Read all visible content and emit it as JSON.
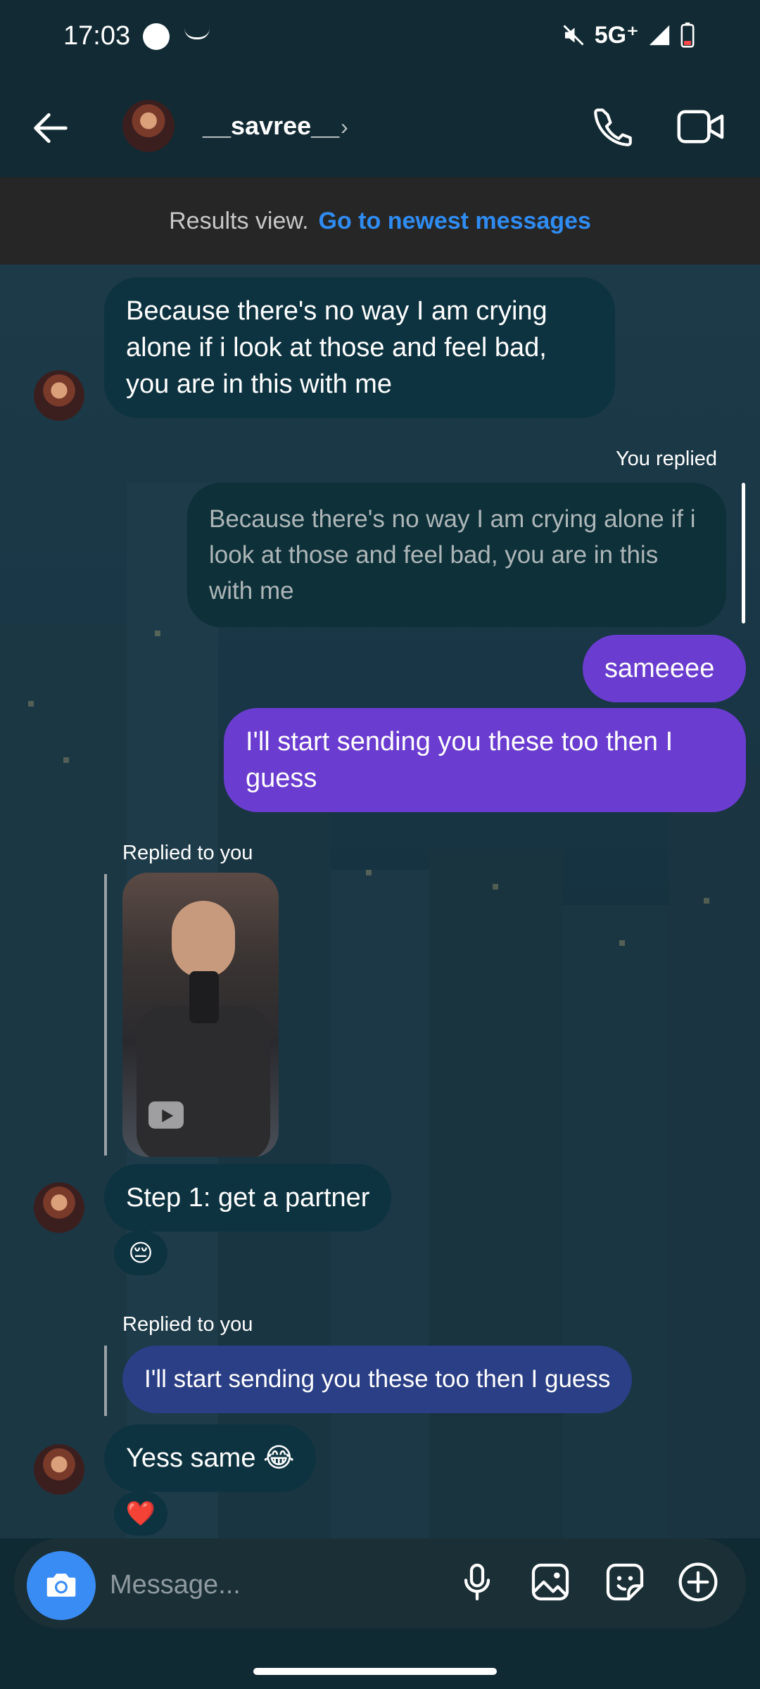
{
  "status_bar": {
    "time": "17:03",
    "network": "5G⁺",
    "icons": [
      "circle-icon",
      "amazon-smile-icon",
      "mute-icon",
      "signal-icon",
      "battery-icon"
    ]
  },
  "header": {
    "username": "__savree__",
    "icons": [
      "back-arrow-icon",
      "avatar",
      "chevron-right-icon",
      "phone-icon",
      "video-icon"
    ]
  },
  "banner": {
    "prefix": "Results view.",
    "link": "Go to newest messages"
  },
  "messages": [
    {
      "type": "incoming",
      "text": "Because there's no way I am crying alone if i look at those and feel bad, you are in this with me"
    },
    {
      "type": "reply_label",
      "text": "You replied"
    },
    {
      "type": "quoted",
      "text": "Because there's no way I am crying alone if i look at those and feel bad, you are in this with me"
    },
    {
      "type": "outgoing",
      "text": "sameeee"
    },
    {
      "type": "outgoing",
      "text": "I'll start sending you these too then I guess"
    },
    {
      "type": "reply_label",
      "text": "Replied to you"
    },
    {
      "type": "incoming",
      "text": "Step 1: get a partner",
      "reaction": "😔"
    },
    {
      "type": "reply_label",
      "text": "Replied to you"
    },
    {
      "type": "quoted",
      "text": "I'll start sending you these too then I guess"
    },
    {
      "type": "incoming",
      "text": "Yess same 😂",
      "reaction": "❤️"
    }
  ],
  "composer": {
    "placeholder": "Message...",
    "icons": [
      "camera-icon",
      "microphone-icon",
      "gallery-icon",
      "sticker-icon",
      "plus-icon"
    ]
  },
  "colors": {
    "outgoing_bubble": "#6a3cd0",
    "incoming_bubble": "#0e3340",
    "link": "#2f8cf3",
    "camera_button": "#3a8cf5"
  }
}
